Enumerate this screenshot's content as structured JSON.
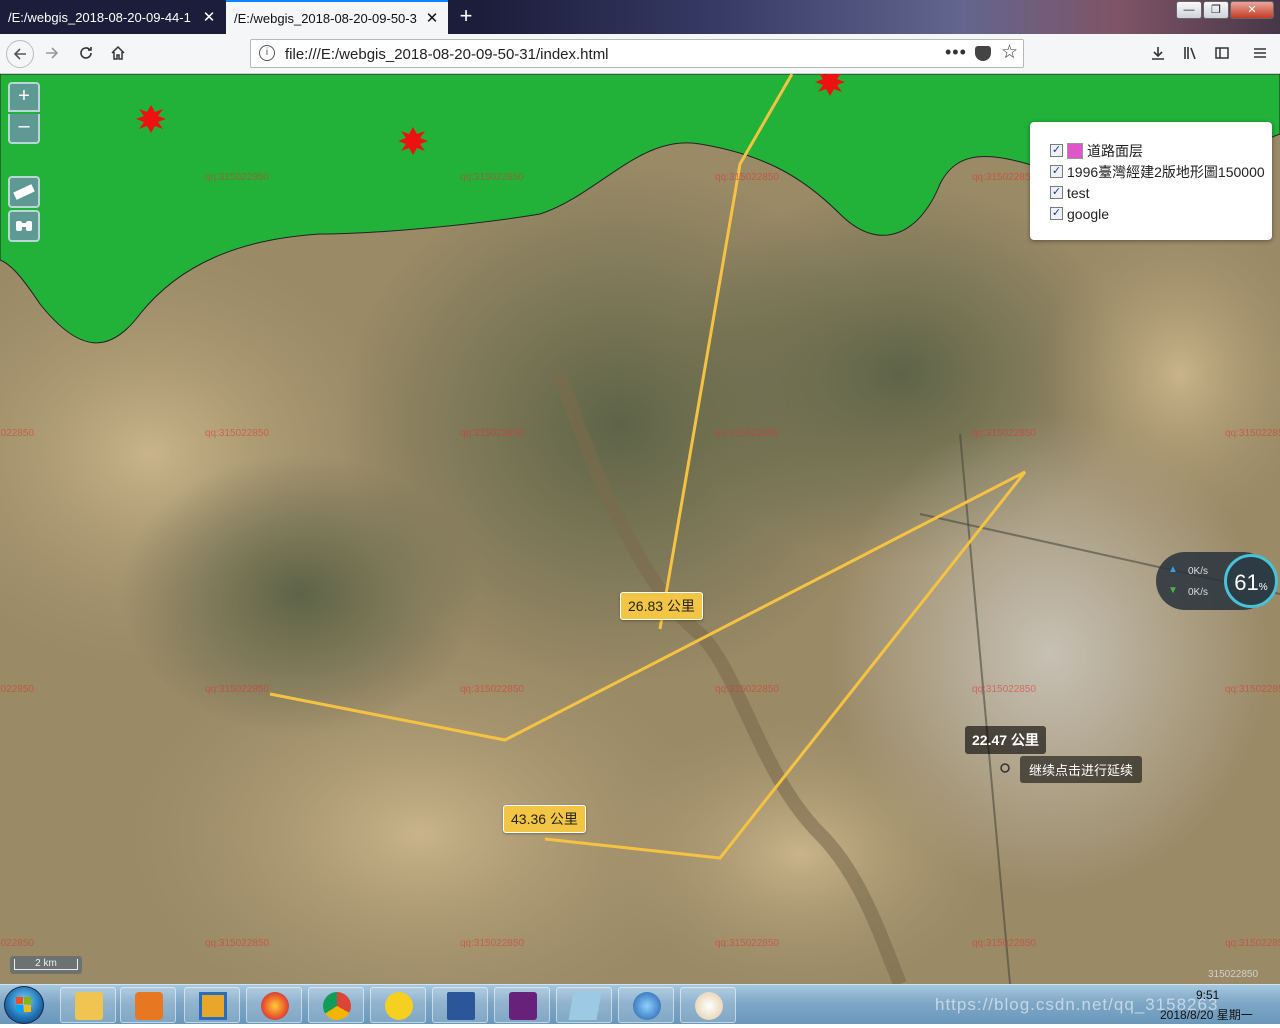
{
  "browser": {
    "tabs": [
      {
        "title": "/E:/webgis_2018-08-20-09-44-1",
        "close": "✕"
      },
      {
        "title": "/E:/webgis_2018-08-20-09-50-3",
        "close": "✕"
      }
    ],
    "new_tab": "+",
    "window_buttons": {
      "minimize": "—",
      "maximize": "❐",
      "close": "✕"
    },
    "url": "file:///E:/webgis_2018-08-20-09-50-31/index.html",
    "url_more": "•••",
    "nav_icons": [
      "back-icon",
      "forward-icon",
      "reload-icon",
      "home-icon",
      "download-icon",
      "library-icon",
      "sidebar-icon",
      "menu-icon"
    ]
  },
  "map": {
    "zoom_in": "+",
    "zoom_out": "–",
    "layer_switcher": {
      "layers": [
        {
          "label": "道路面层",
          "checked": true,
          "swatch_color": "#e055c8"
        },
        {
          "label": "1996臺灣經建2版地形圖150000",
          "checked": true
        },
        {
          "label": "test",
          "checked": true
        },
        {
          "label": "google",
          "checked": true
        }
      ]
    },
    "measure_labels": [
      {
        "text": "26.83 公里"
      },
      {
        "text": "43.36 公里"
      }
    ],
    "measure_total": "22.47 公里",
    "measure_hint": "继续点击进行延续",
    "scale_text": "2 km",
    "watermark_text": "qq:315022850",
    "corner_text": "315022850",
    "overlay_color": "#22b23a",
    "line_color": "#f5c242",
    "marker_color": "#ee1111"
  },
  "net_widget": {
    "up": "0K/s",
    "down": "0K/s",
    "percent": "61",
    "percent_sign": "%"
  },
  "taskbar": {
    "apps": [
      "file-explorer-icon",
      "media-player-icon",
      "app-window-icon",
      "firefox-icon",
      "chrome-icon",
      "music-app-icon",
      "word-icon",
      "visual-studio-icon",
      "editor-icon",
      "globe-app-icon",
      "paint-icon"
    ],
    "time": "9:51",
    "date": "2018/8/20 星期一",
    "watermark": "https://blog.csdn.net/qq_3158263"
  }
}
